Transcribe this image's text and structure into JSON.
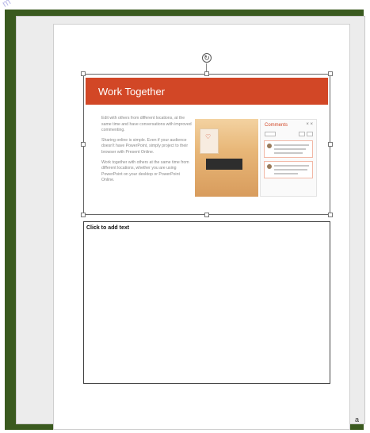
{
  "watermark": "m",
  "rotate_icon": "rotate-icon",
  "slide": {
    "title": "Work Together",
    "paragraphs": [
      "Edit with others from different locations, at the same time and have conversations with improved commenting.",
      "Sharing online is simple. Even if your audience doesn't have PowerPoint, simply project to their browser with Present Online.",
      "Work together with others at the same time from different locations, whether you are using PowerPoint on your desktop or PowerPoint Online."
    ],
    "comments_title": "Comments",
    "comments_close": "× ×"
  },
  "notes": {
    "placeholder": "Click to add text"
  },
  "corner_mark": "a"
}
